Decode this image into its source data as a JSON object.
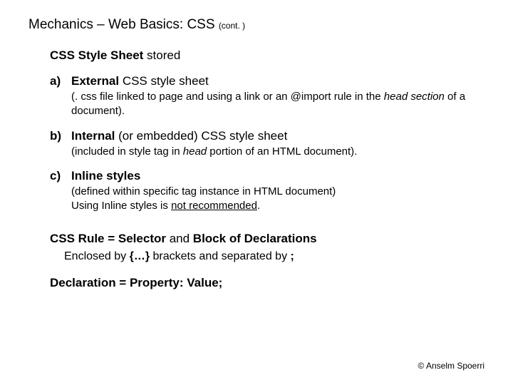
{
  "title": {
    "main": "Mechanics – Web Basics: CSS",
    "cont": "(cont. )"
  },
  "heading": {
    "bold": "CSS Style Sheet",
    "rest": " stored"
  },
  "items": [
    {
      "marker": "a)",
      "label_bold": "External",
      "label_rest": " CSS style sheet",
      "desc_pre": "(. css file linked to page and using a link or an @import rule in the ",
      "desc_italic": "head section",
      "desc_post": " of a document)."
    },
    {
      "marker": "b)",
      "label_bold": "Internal",
      "label_rest": " (or embedded) CSS style sheet",
      "desc_pre": "(included in style tag in ",
      "desc_italic": "head",
      "desc_post": " portion of an HTML document)."
    },
    {
      "marker": "c)",
      "label_bold": "Inline styles",
      "label_rest": "",
      "desc_pre": "(defined within specific tag instance in HTML document)",
      "desc_br": "Using Inline styles is ",
      "desc_underline": "not recommended",
      "desc_end": "."
    }
  ],
  "rule": {
    "line1_bold1": "CSS Rule = Selector",
    "line1_mid": " and ",
    "line1_bold2": "Block of Declarations",
    "line2_pre": "Enclosed by ",
    "line2_b1": "{…}",
    "line2_mid": " brackets and separated by ",
    "line2_b2": ";"
  },
  "declaration": "Declaration = Property: Value;",
  "footer": "© Anselm Spoerri"
}
